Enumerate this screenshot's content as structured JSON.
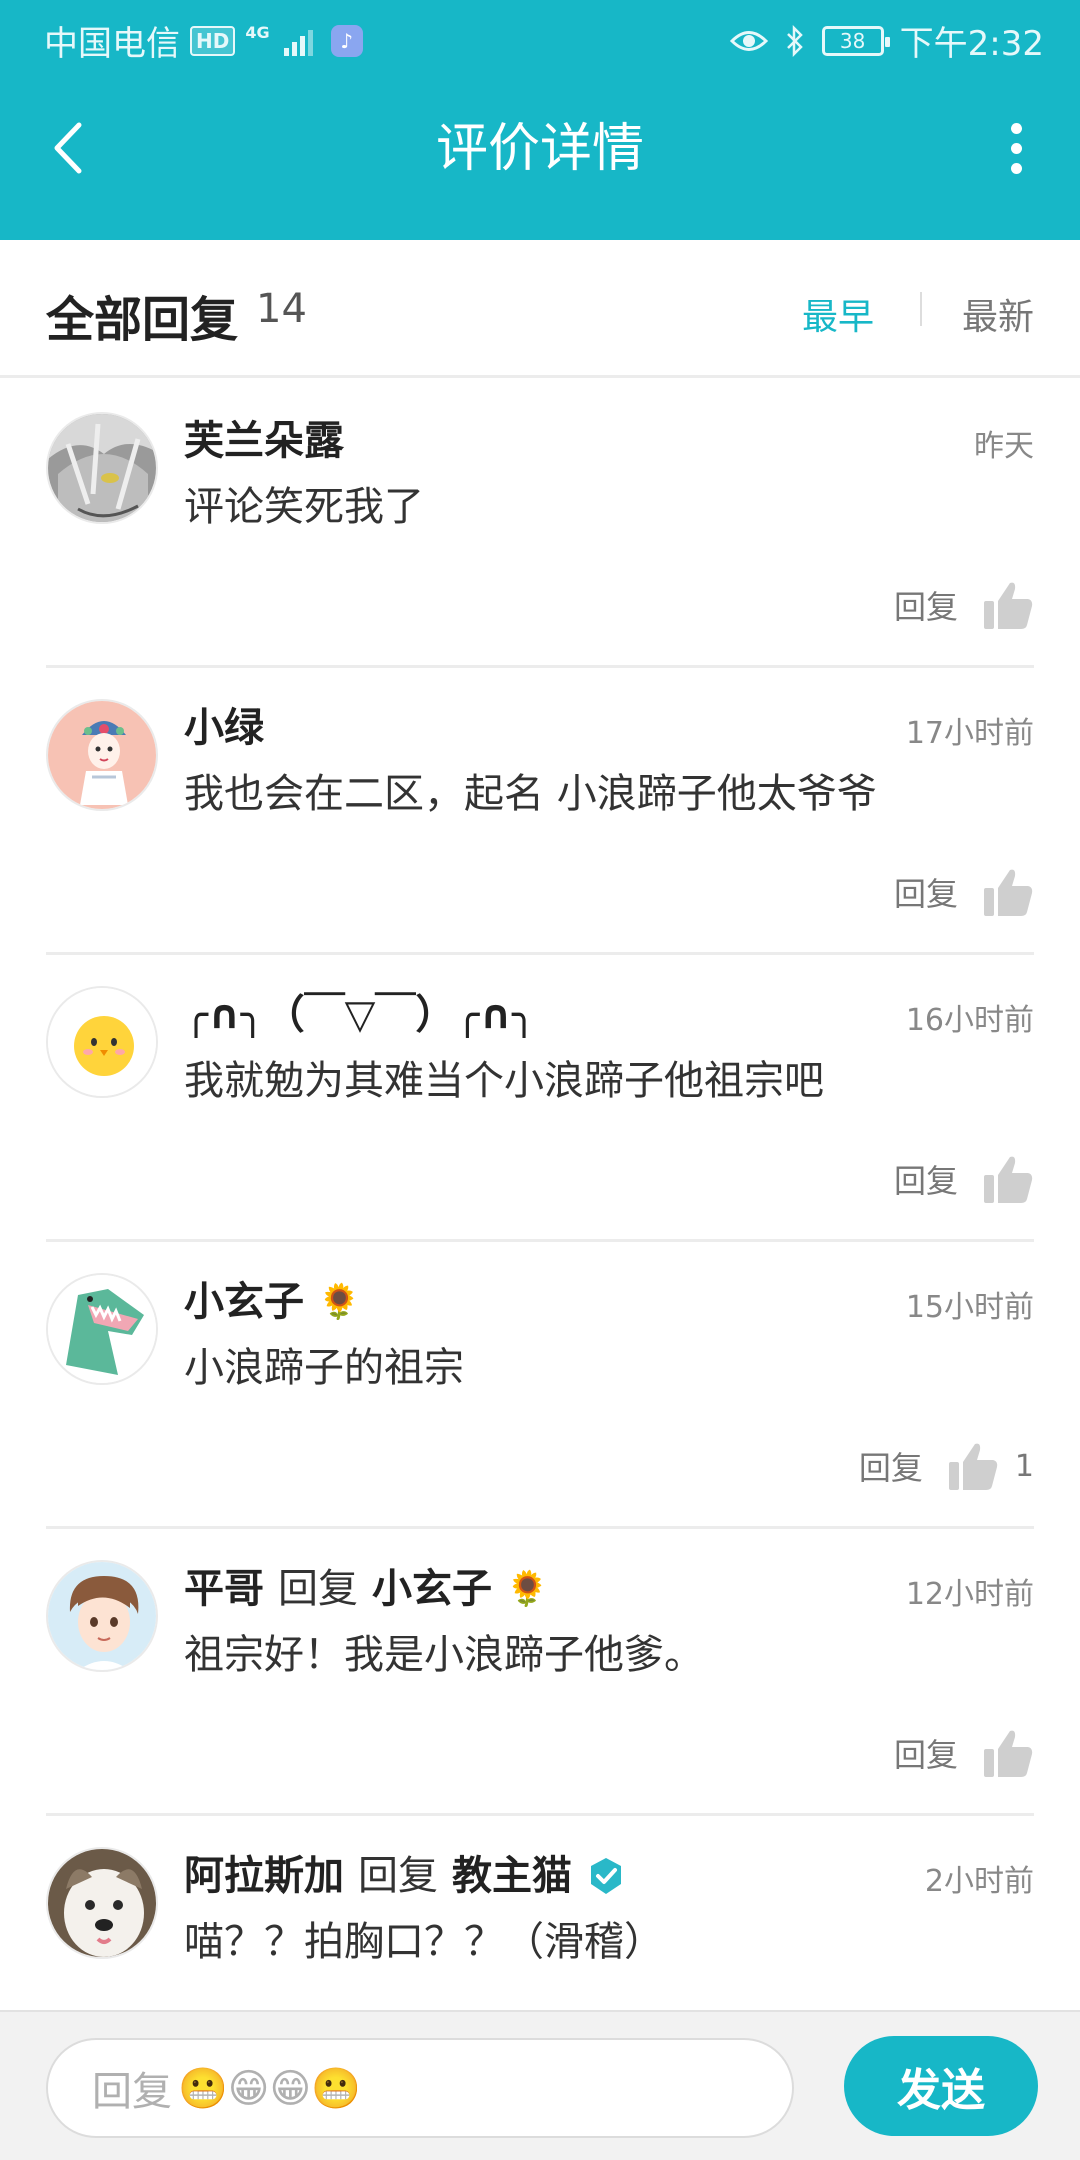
{
  "status_bar": {
    "carrier": "中国电信",
    "hd": "HD",
    "network": "4G",
    "battery": "38",
    "time": "下午2:32"
  },
  "app_bar": {
    "title": "评价详情"
  },
  "replies_header": {
    "title": "全部回复",
    "count": "14",
    "sort_earliest": "最早",
    "sort_newest": "最新",
    "active_sort": "最早"
  },
  "comments": [
    {
      "name": "芙兰朵露",
      "time": "昨天",
      "text": "评论笑死我了",
      "reply_label": "回复",
      "likes": ""
    },
    {
      "name": "小绿",
      "time": "17小时前",
      "text": "我也会在二区，起名  小浪蹄子他太爷爷",
      "reply_label": "回复",
      "likes": ""
    },
    {
      "name": "╭∩╮（￣▽￣）╭∩╮",
      "time": "16小时前",
      "text": "我就勉为其难当个小浪蹄子他祖宗吧",
      "reply_label": "回复",
      "likes": ""
    },
    {
      "name": "小玄子",
      "flower": "🌻",
      "time": "15小时前",
      "text": "小浪蹄子的祖宗",
      "reply_label": "回复",
      "likes": "1"
    },
    {
      "name": "平哥",
      "reply_word": "回复",
      "target": "小玄子",
      "flower": "🌻",
      "time": "12小时前",
      "text": "祖宗好！我是小浪蹄子他爹。",
      "reply_label": "回复",
      "likes": ""
    },
    {
      "name": "阿拉斯加",
      "reply_word": "回复",
      "target": "教主猫",
      "time": "2小时前",
      "text": "喵？？拍胸口？？（滑稽）"
    }
  ],
  "input": {
    "placeholder": "回复",
    "emojis": "😬😁😁😬"
  },
  "send_label": "发送",
  "colors": {
    "accent": "#17b7c7",
    "divider": "#ececec",
    "muted_text": "#777777"
  }
}
